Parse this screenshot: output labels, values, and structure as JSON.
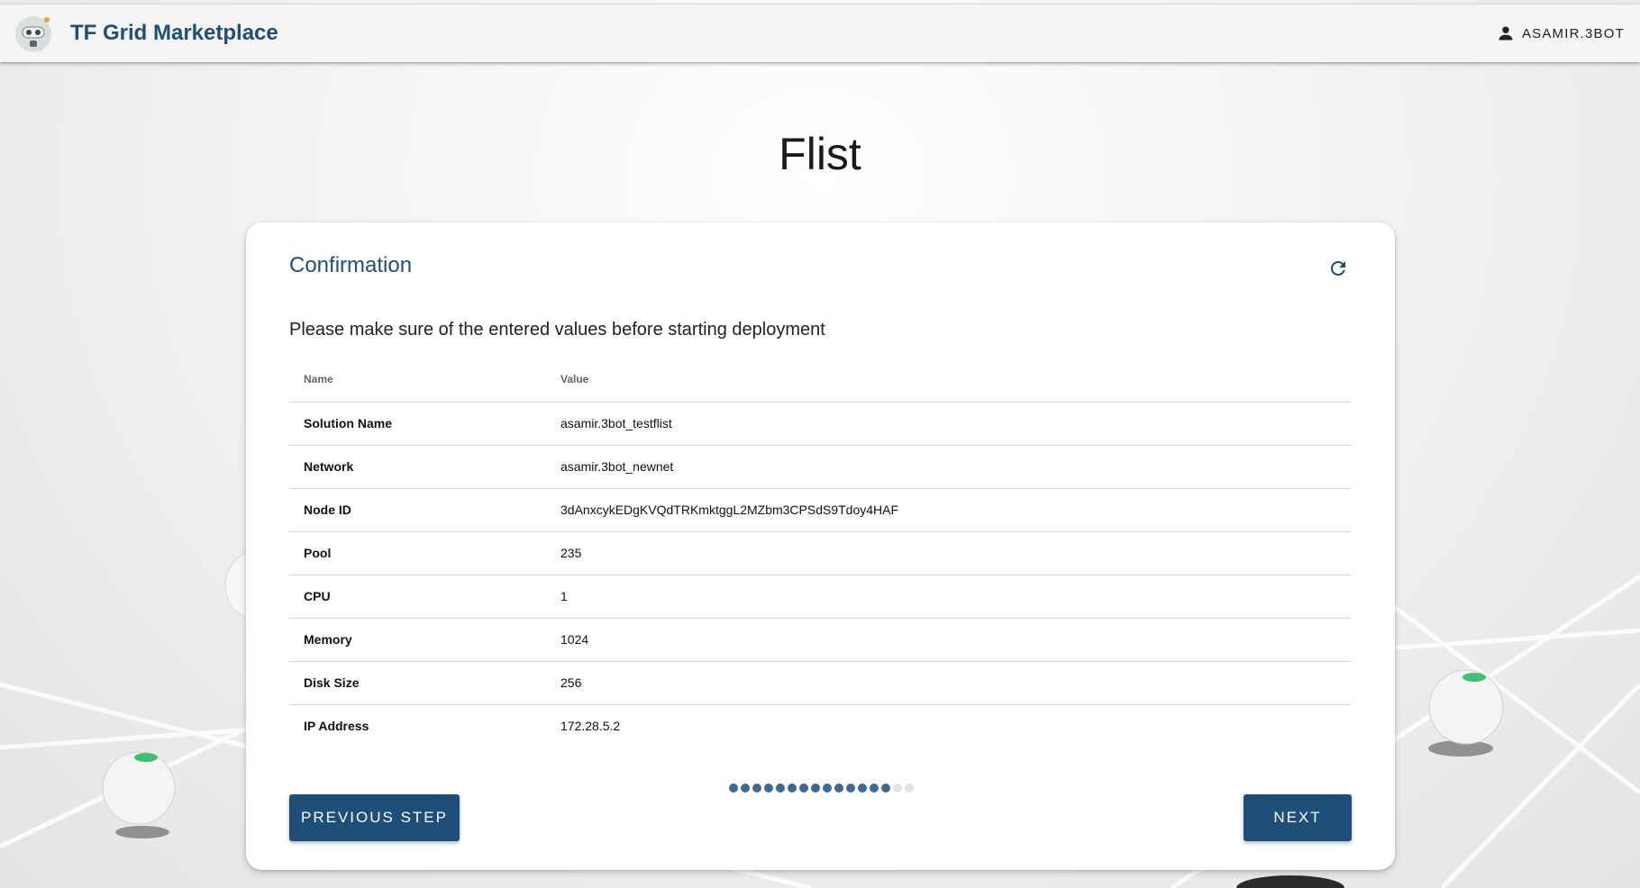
{
  "header": {
    "app_title": "TF Grid Marketplace",
    "user_name": "ASAMIR.3BOT",
    "logo_icon": "robot-logo-icon",
    "user_icon": "person-icon"
  },
  "page": {
    "heading": "Flist"
  },
  "card": {
    "title": "Confirmation",
    "refresh_icon": "refresh-icon",
    "subtitle": "Please make sure of the entered values before starting deployment",
    "table": {
      "columns": [
        "Name",
        "Value"
      ],
      "rows": [
        {
          "name": "Solution Name",
          "value": "asamir.3bot_testflist"
        },
        {
          "name": "Network",
          "value": "asamir.3bot_newnet"
        },
        {
          "name": "Node ID",
          "value": "3dAnxcykEDgKVQdTRKmktggL2MZbm3CPSdS9Tdoy4HAF"
        },
        {
          "name": "Pool",
          "value": "235"
        },
        {
          "name": "CPU",
          "value": "1"
        },
        {
          "name": "Memory",
          "value": "1024"
        },
        {
          "name": "Disk Size",
          "value": "256"
        },
        {
          "name": "IP Address",
          "value": "172.28.5.2"
        }
      ]
    },
    "progress": {
      "total_steps": 16,
      "completed_steps": 14
    },
    "buttons": {
      "previous_label": "PREVIOUS STEP",
      "next_label": "NEXT"
    }
  },
  "colors": {
    "primary": "#1f4e79",
    "dot_active": "#3f6a8f",
    "dot_inactive": "#e3e3e3"
  }
}
